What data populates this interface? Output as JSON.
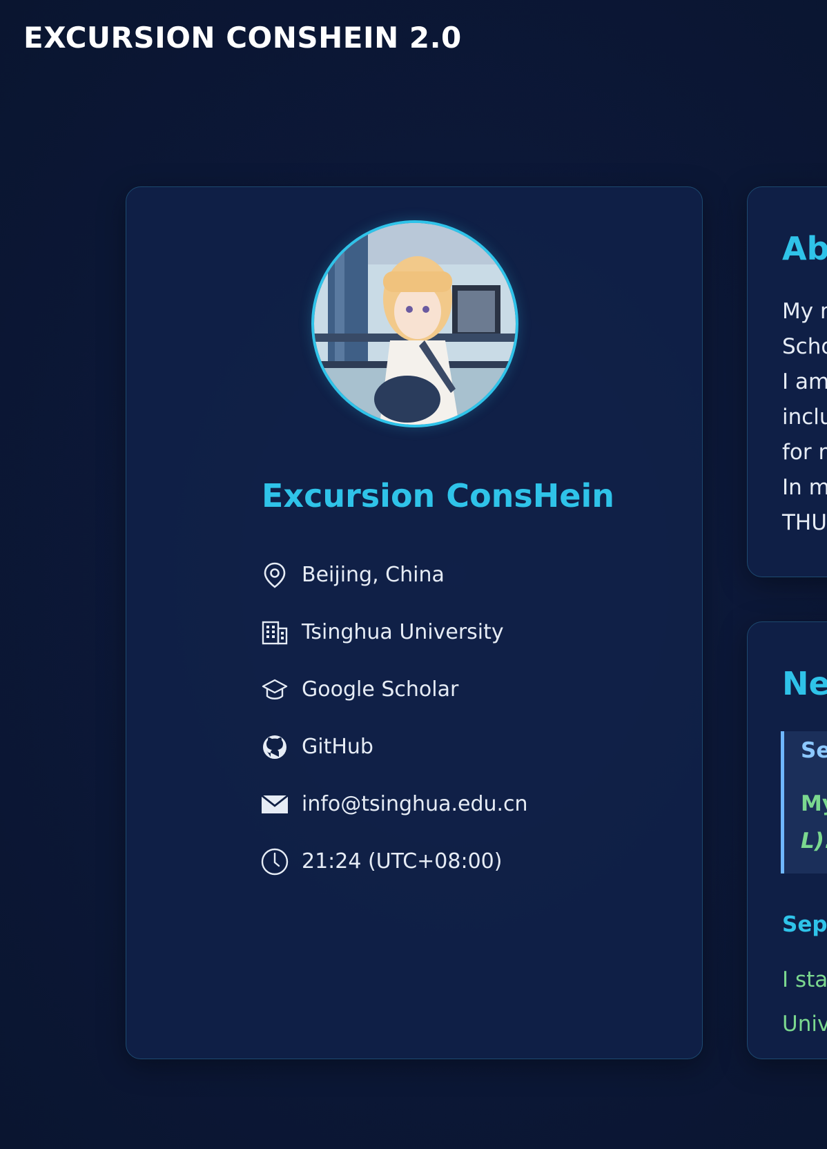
{
  "header": {
    "site_title": "EXCURSION CONSHEIN 2.0"
  },
  "profile": {
    "name": "Excursion ConsHein",
    "avatar_alt": "anime-girl-avatar",
    "info": [
      {
        "icon": "location-pin-icon",
        "text": "Beijing, China"
      },
      {
        "icon": "building-icon",
        "text": "Tsinghua University"
      },
      {
        "icon": "graduation-cap-icon",
        "text": "Google Scholar"
      },
      {
        "icon": "github-icon",
        "text": "GitHub"
      },
      {
        "icon": "mail-icon",
        "text": "info@tsinghua.edu.cn"
      },
      {
        "icon": "clock-icon",
        "text": "21:24 (UTC+08:00)"
      }
    ]
  },
  "about": {
    "title": "Ab",
    "lines": [
      "My r",
      "Scho",
      "I am",
      "inclu",
      "for m",
      "In my",
      "THU."
    ]
  },
  "news": {
    "title": "Ne",
    "highlight": {
      "date": "Se",
      "text_line1": "My",
      "text_line2": "L)!"
    },
    "item": {
      "date": "Sep",
      "text_line1": "I star",
      "text_line2": "Unive"
    }
  },
  "colors": {
    "accent": "#2fc3e9",
    "green": "#7bd88f",
    "highlight_border": "#6fb7ff",
    "background": "#0c1838"
  }
}
